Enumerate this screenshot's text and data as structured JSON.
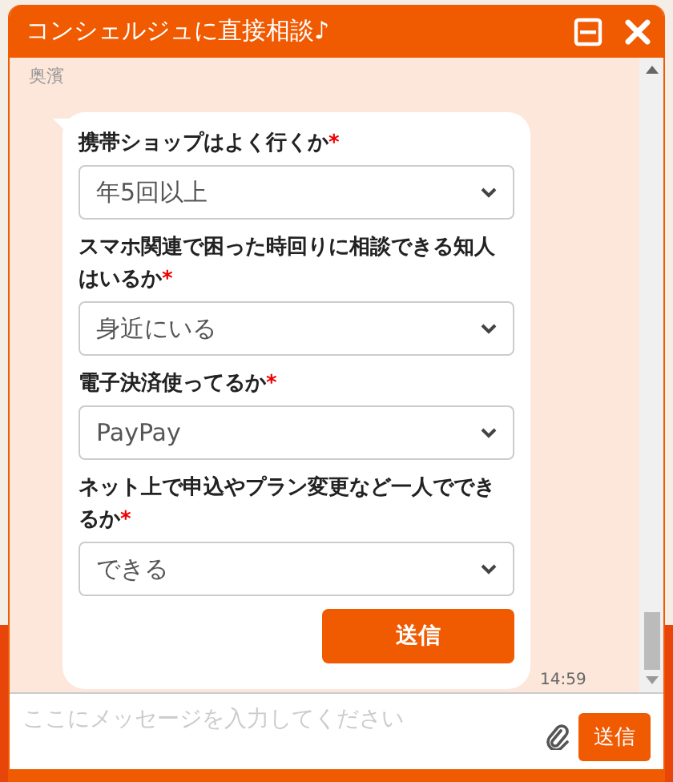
{
  "window": {
    "title": "コンシェルジュに直接相談♪"
  },
  "agent": {
    "name": "奥濱"
  },
  "form": {
    "questions": [
      {
        "label": "携帯ショップはよく行くか",
        "required_mark": "*",
        "value": "年5回以上"
      },
      {
        "label": "スマホ関連で困った時回りに相談できる知人はいるか",
        "required_mark": "*",
        "value": "身近にいる"
      },
      {
        "label": "電子決済使ってるか",
        "required_mark": "*",
        "value": "PayPay"
      },
      {
        "label": "ネット上で申込やプラン変更など一人でできるか",
        "required_mark": "*",
        "value": "できる"
      }
    ],
    "submit": "送信"
  },
  "message_time": "14:59",
  "composer": {
    "placeholder": "ここにメッセージを入力してください",
    "send": "送信"
  }
}
